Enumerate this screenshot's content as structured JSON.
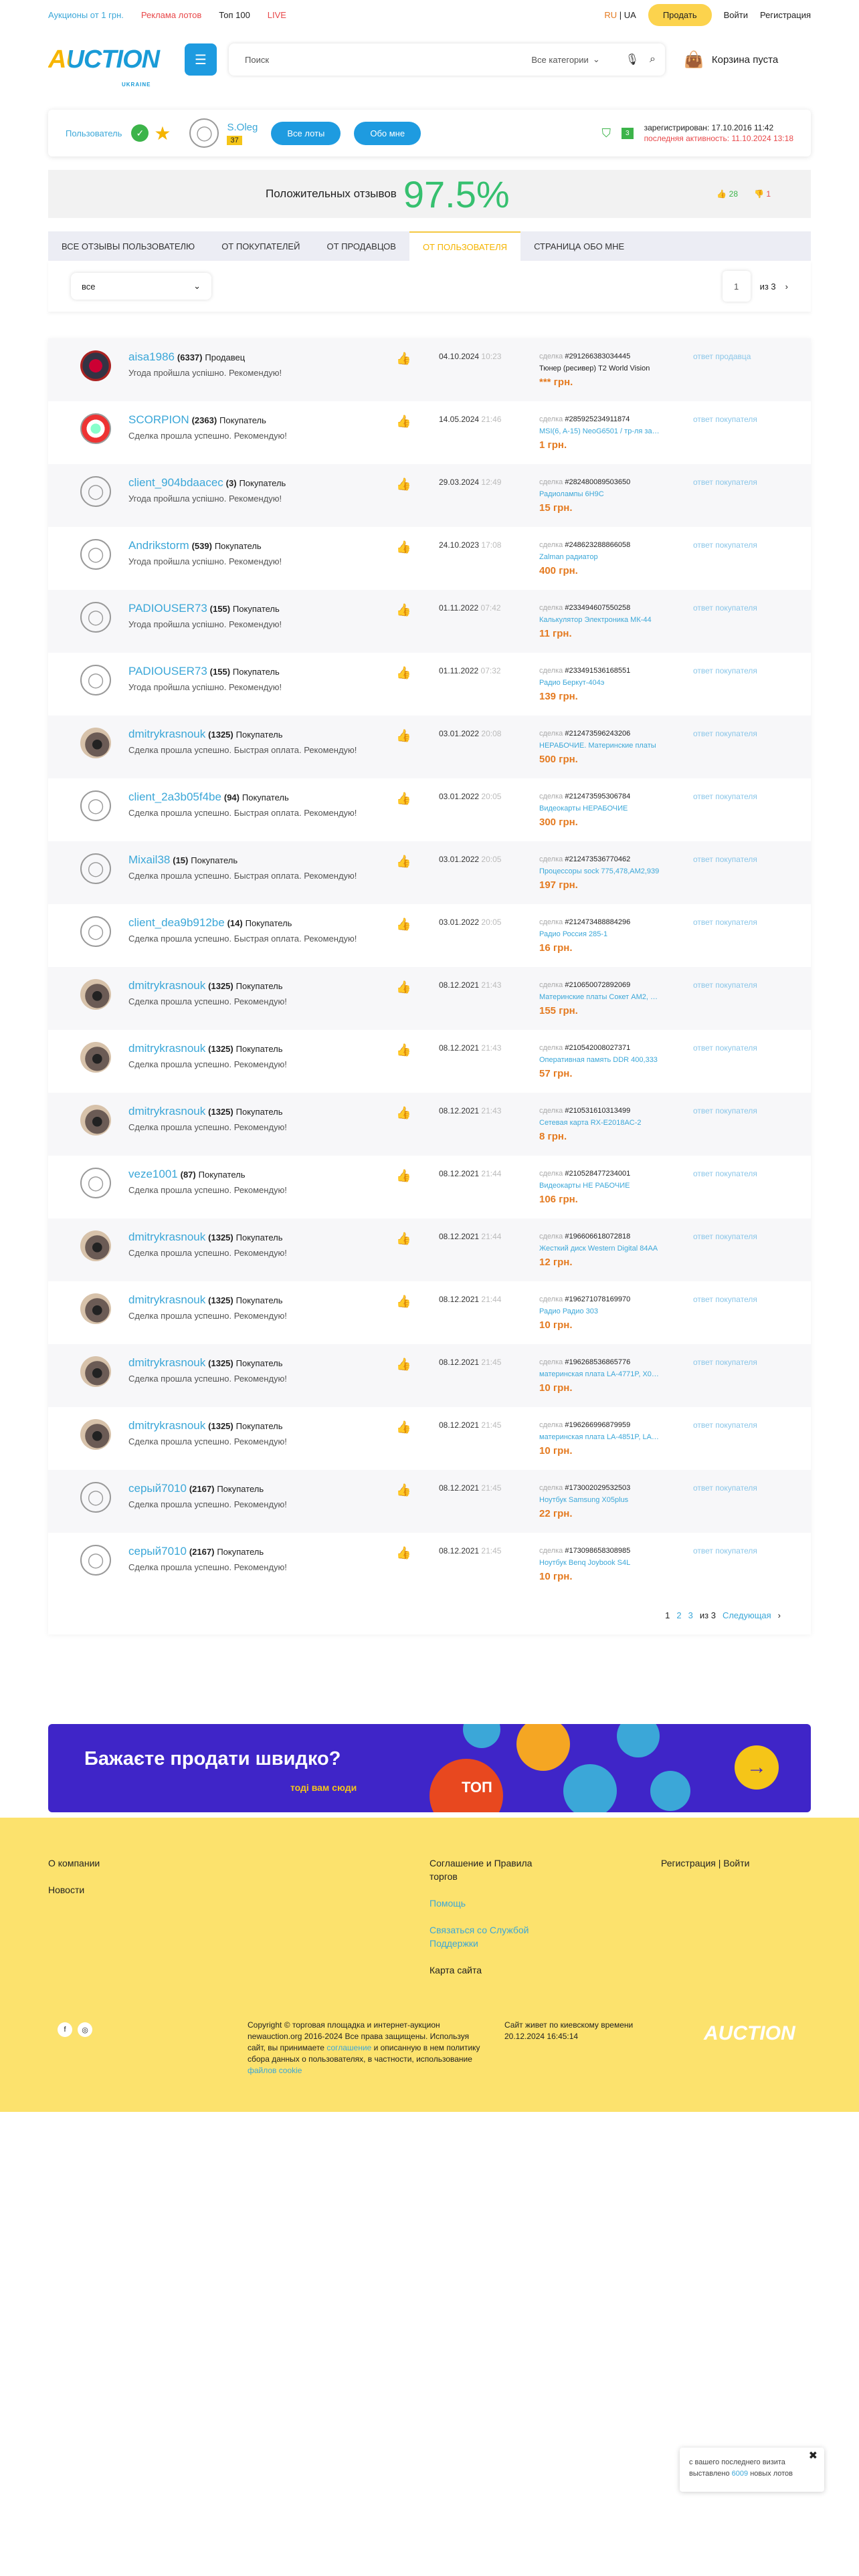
{
  "topbar": {
    "links": [
      {
        "label": "Аукционы от 1 грн.",
        "color": "#3ba7d8"
      },
      {
        "label": "Реклама лотов",
        "color": "#e8484a"
      },
      {
        "label": "Топ 100",
        "color": "#222"
      },
      {
        "label": "LIVE",
        "color": "#e8484a"
      }
    ],
    "lang_ru": "RU",
    "lang_sep": "|",
    "lang_ua": "UA",
    "sell": "Продать",
    "login": "Войти",
    "register": "Регистрация"
  },
  "header": {
    "logo": "AUCTION",
    "logo_sub": "UKRAINE",
    "search_placeholder": "Поиск",
    "search_category": "Все категории",
    "cart": "Корзина пуста"
  },
  "user": {
    "label": "Пользователь",
    "name": "S.Oleg",
    "rating": "37",
    "btn_lots": "Все лоты",
    "btn_about": "Обо мне",
    "green_box": "3",
    "registered": "зарегистрирован: 17.10.2016 11:42",
    "last_active": "последняя активность: 11.10.2024 13:18"
  },
  "feedback": {
    "label": "Положительных отзывов",
    "value": "97.5%",
    "positive": "28",
    "negative": "1"
  },
  "tabs": [
    {
      "label": "ВСЕ ОТЗЫВЫ ПОЛЬЗОВАТЕЛЮ",
      "active": false
    },
    {
      "label": "ОТ ПОКУПАТЕЛЕЙ",
      "active": false
    },
    {
      "label": "ОТ ПРОДАВЦОВ",
      "active": false
    },
    {
      "label": "ОТ ПОЛЬЗОВАТЕЛЯ",
      "active": true
    },
    {
      "label": "СТРАНИЦА ОБО МНЕ",
      "active": false
    }
  ],
  "filter": {
    "value": "все"
  },
  "pager_top": {
    "current": "1",
    "of": "из 3"
  },
  "deal_label": "сделка",
  "reviews": [
    {
      "av": "c1",
      "name": "aisa1986",
      "count": "(6337)",
      "role": "Продавец",
      "text": "Угода пройшла успішно. Рекомендую!",
      "date": "04.10.2024",
      "time": "10:23",
      "lot": "#291266383034445",
      "title": "Тюнер (ресивер) T2 World Vision",
      "title_dark": true,
      "price": "*** грн.",
      "answer": "ответ продавца"
    },
    {
      "av": "c2",
      "name": "SCORPION",
      "count": "(2363)",
      "role": "Покупатель",
      "text": "Сделка прошла успешно. Рекомендую!",
      "date": "14.05.2024",
      "time": "21:46",
      "lot": "#285925234911874",
      "title": "MSI(6, A-15) NeoG6501 / тр-ля запча...",
      "title_dark": false,
      "price": "1 грн.",
      "answer": "ответ покупателя"
    },
    {
      "av": "def",
      "name": "client_904bdaacec",
      "count": "(3)",
      "role": "Покупатель",
      "text": "Угода пройшла успішно. Рекомендую!",
      "date": "29.03.2024",
      "time": "12:49",
      "lot": "#282480089503650",
      "title": "Радиолампы 6Н9С",
      "title_dark": false,
      "price": "15 грн.",
      "answer": "ответ покупателя"
    },
    {
      "av": "def",
      "name": "Andrikstorm",
      "count": "(539)",
      "role": "Покупатель",
      "text": "Угода пройшла успішно. Рекомендую!",
      "date": "24.10.2023",
      "time": "17:08",
      "lot": "#248623288866058",
      "title": "Zalman радиатор",
      "title_dark": false,
      "price": "400 грн.",
      "answer": "ответ покупателя"
    },
    {
      "av": "def",
      "name": "PADIOUSER73",
      "count": "(155)",
      "role": "Покупатель",
      "text": "Угода пройшла успішно. Рекомендую!",
      "date": "01.11.2022",
      "time": "07:42",
      "lot": "#233494607550258",
      "title": "Калькулятор Электроника МК-44",
      "title_dark": false,
      "price": "11 грн.",
      "answer": "ответ покупателя"
    },
    {
      "av": "def",
      "name": "PADIOUSER73",
      "count": "(155)",
      "role": "Покупатель",
      "text": "Угода пройшла успішно. Рекомендую!",
      "date": "01.11.2022",
      "time": "07:32",
      "lot": "#233491536168551",
      "title": "Радио Беркут-404э",
      "title_dark": false,
      "price": "139 грн.",
      "answer": "ответ покупателя"
    },
    {
      "av": "c3",
      "name": "dmitrykrasnouk",
      "count": "(1325)",
      "role": "Покупатель",
      "text": "Сделка прошла успешно. Быстрая оплата. Рекомендую!",
      "date": "03.01.2022",
      "time": "20:08",
      "lot": "#212473596243206",
      "title": "НЕРАБОЧИЕ. Материнские платы",
      "title_dark": false,
      "price": "500 грн.",
      "answer": "ответ покупателя"
    },
    {
      "av": "def",
      "name": "client_2a3b05f4be",
      "count": "(94)",
      "role": "Покупатель",
      "text": "Сделка прошла успешно. Быстрая оплата. Рекомендую!",
      "date": "03.01.2022",
      "time": "20:05",
      "lot": "#212473595306784",
      "title": "Видеокарты НЕРАБОЧИЕ",
      "title_dark": false,
      "price": "300 грн.",
      "answer": "ответ покупателя"
    },
    {
      "av": "def",
      "name": "Mixail38",
      "count": "(15)",
      "role": "Покупатель",
      "text": "Сделка прошла успешно. Быстрая оплата. Рекомендую!",
      "date": "03.01.2022",
      "time": "20:05",
      "lot": "#212473536770462",
      "title": "Процессоры sock 775,478,AM2,939",
      "title_dark": false,
      "price": "197 грн.",
      "answer": "ответ покупателя"
    },
    {
      "av": "def",
      "name": "client_dea9b912be",
      "count": "(14)",
      "role": "Покупатель",
      "text": "Сделка прошла успешно. Быстрая оплата. Рекомендую!",
      "date": "03.01.2022",
      "time": "20:05",
      "lot": "#212473488884296",
      "title": "Радио Россия 285-1",
      "title_dark": false,
      "price": "16 грн.",
      "answer": "ответ покупателя"
    },
    {
      "av": "c3",
      "name": "dmitrykrasnouk",
      "count": "(1325)",
      "role": "Покупатель",
      "text": "Сделка прошла успешно. Рекомендую!",
      "date": "08.12.2021",
      "time": "21:43",
      "lot": "#210650072892069",
      "title": "Материнские платы Сокет AM2, 7...",
      "title_dark": false,
      "price": "155 грн.",
      "answer": "ответ покупателя"
    },
    {
      "av": "c3",
      "name": "dmitrykrasnouk",
      "count": "(1325)",
      "role": "Покупатель",
      "text": "Сделка прошла успешно. Рекомендую!",
      "date": "08.12.2021",
      "time": "21:43",
      "lot": "#210542008027371",
      "title": "Оперативная память DDR 400,333",
      "title_dark": false,
      "price": "57 грн.",
      "answer": "ответ покупателя"
    },
    {
      "av": "c3",
      "name": "dmitrykrasnouk",
      "count": "(1325)",
      "role": "Покупатель",
      "text": "Сделка прошла успешно. Рекомендую!",
      "date": "08.12.2021",
      "time": "21:43",
      "lot": "#210531610313499",
      "title": "Сетевая карта RX-E2018AC-2",
      "title_dark": false,
      "price": "8 грн.",
      "answer": "ответ покупателя"
    },
    {
      "av": "def",
      "name": "veze1001",
      "count": "(87)",
      "role": "Покупатель",
      "text": "Сделка прошла успешно. Рекомендую!",
      "date": "08.12.2021",
      "time": "21:44",
      "lot": "#210528477234001",
      "title": "Видеокарты НЕ РАБОЧИЕ",
      "title_dark": false,
      "price": "106 грн.",
      "answer": "ответ покупателя"
    },
    {
      "av": "c3",
      "name": "dmitrykrasnouk",
      "count": "(1325)",
      "role": "Покупатель",
      "text": "Сделка прошла успешно. Рекомендую!",
      "date": "08.12.2021",
      "time": "21:44",
      "lot": "#196606618072818",
      "title": "Жесткий диск Western Digital 84AA",
      "title_dark": false,
      "price": "12 грн.",
      "answer": "ответ покупателя"
    },
    {
      "av": "c3",
      "name": "dmitrykrasnouk",
      "count": "(1325)",
      "role": "Покупатель",
      "text": "Сделка прошла успешно. Рекомендую!",
      "date": "08.12.2021",
      "time": "21:44",
      "lot": "#196271078169970",
      "title": "Радио Радио 303",
      "title_dark": false,
      "price": "10 грн.",
      "answer": "ответ покупателя"
    },
    {
      "av": "c3",
      "name": "dmitrykrasnouk",
      "count": "(1325)",
      "role": "Покупатель",
      "text": "Сделка прошла успешно. Рекомендую!",
      "date": "08.12.2021",
      "time": "21:45",
      "lot": "#196268536865776",
      "title": "материнская плата LA-4771P, X05...",
      "title_dark": false,
      "price": "10 грн.",
      "answer": "ответ покупателя"
    },
    {
      "av": "c3",
      "name": "dmitrykrasnouk",
      "count": "(1325)",
      "role": "Покупатель",
      "text": "Сделка прошла успешно. Рекомендую!",
      "date": "08.12.2021",
      "time": "21:45",
      "lot": "#196266996879959",
      "title": "материнская плата LA-4851P, LA-...",
      "title_dark": false,
      "price": "10 грн.",
      "answer": "ответ покупателя"
    },
    {
      "av": "def",
      "name": "серый7010",
      "count": "(2167)",
      "role": "Покупатель",
      "text": "Сделка прошла успешно. Рекомендую!",
      "date": "08.12.2021",
      "time": "21:45",
      "lot": "#173002029532503",
      "title": "Ноутбук Samsung X05plus",
      "title_dark": false,
      "price": "22 грн.",
      "answer": "ответ покупателя"
    },
    {
      "av": "def",
      "name": "серый7010",
      "count": "(2167)",
      "role": "Покупатель",
      "text": "Сделка прошла успешно. Рекомендую!",
      "date": "08.12.2021",
      "time": "21:45",
      "lot": "#173098658308985",
      "title": "Ноутбук Benq Joybook S4L",
      "title_dark": false,
      "price": "10 грн.",
      "answer": "ответ покупателя"
    }
  ],
  "pager_bottom": {
    "p1": "1",
    "p2": "2",
    "p3": "3",
    "of": "из 3",
    "next": "Следующая"
  },
  "banner": {
    "headline": "Бажаєте продати швидко?",
    "sub": "тоді вам сюди",
    "tag": "ТОП"
  },
  "footer": {
    "about": "О компании",
    "news": "Новости",
    "agreement": "Соглашение и Правила торгов",
    "help": "Помощь",
    "support": "Связаться со Службой Поддержки",
    "sitemap": "Карта сайта",
    "register": "Регистрация",
    "login": "Войти",
    "copyright": "Copyright © торговая площадка и интернет-аукцион newauction.org 2016-2024 Все права защищены. Используя сайт, вы принимаете",
    "copyright_link1": "соглашение",
    "copyright_mid": "и описанную в нем политику сбора данных о пользователях, в частности, использование",
    "copyright_link2": "файлов cookie",
    "kiev": "Сайт живет по киевскому времени",
    "kiev_time": "20.12.2024 16:45:14",
    "logo": "AUCTION"
  },
  "toast": {
    "text1": "с вашего последнего визита выставлено",
    "num": "6009",
    "text2": "новых лотов"
  }
}
